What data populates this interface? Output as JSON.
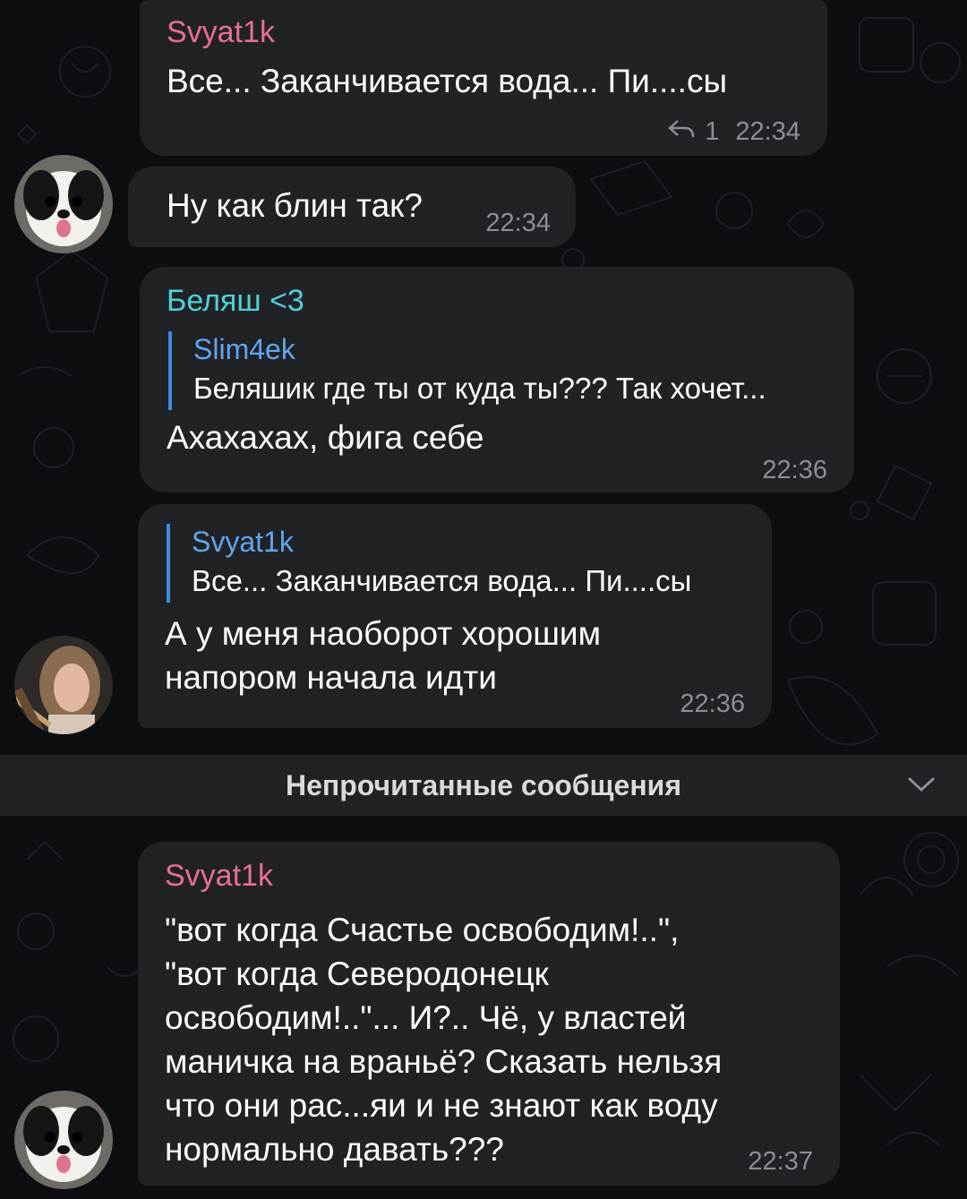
{
  "colors": {
    "sender_pink": "#e86e95",
    "sender_teal": "#4fd1d9",
    "reply_bar": "#3a8de0",
    "bubble_bg": "#212226",
    "meta_text": "#8d8e93"
  },
  "messages": [
    {
      "sender": "Svyat1k",
      "text": "Все... Заканчивается вода... Пи....сы",
      "replies_count": "1",
      "time": "22:34",
      "reply_icon": "reply-arrow-icon"
    },
    {
      "text": "Ну как блин так?",
      "time": "22:34"
    },
    {
      "sender": "Беляш <3",
      "reply_to": {
        "sender": "Slim4ek",
        "text": "Беляшик где ты от куда ты??? Так хочет..."
      },
      "text": "Ахахахах, фига себе",
      "time": "22:36"
    },
    {
      "reply_to": {
        "sender": "Svyat1k",
        "text": "Все... Заканчивается вода... Пи....сы"
      },
      "lines": [
        "А у меня наоборот хорошим",
        "напором начала идти"
      ],
      "time": "22:36"
    },
    {
      "sender": "Svyat1k",
      "lines": [
        "\"вот когда Счастье освободим!..\",",
        "\"вот когда Северодонецк",
        "освободим!..\"... И?.. Чё, у властей",
        "маничка на враньё? Сказать нельзя",
        "что они рас...яи и не знают как воду",
        "нормально давать???"
      ],
      "time": "22:37"
    }
  ],
  "unread_divider": {
    "label": "Непрочитанные сообщения",
    "icon": "chevron-down-icon"
  }
}
